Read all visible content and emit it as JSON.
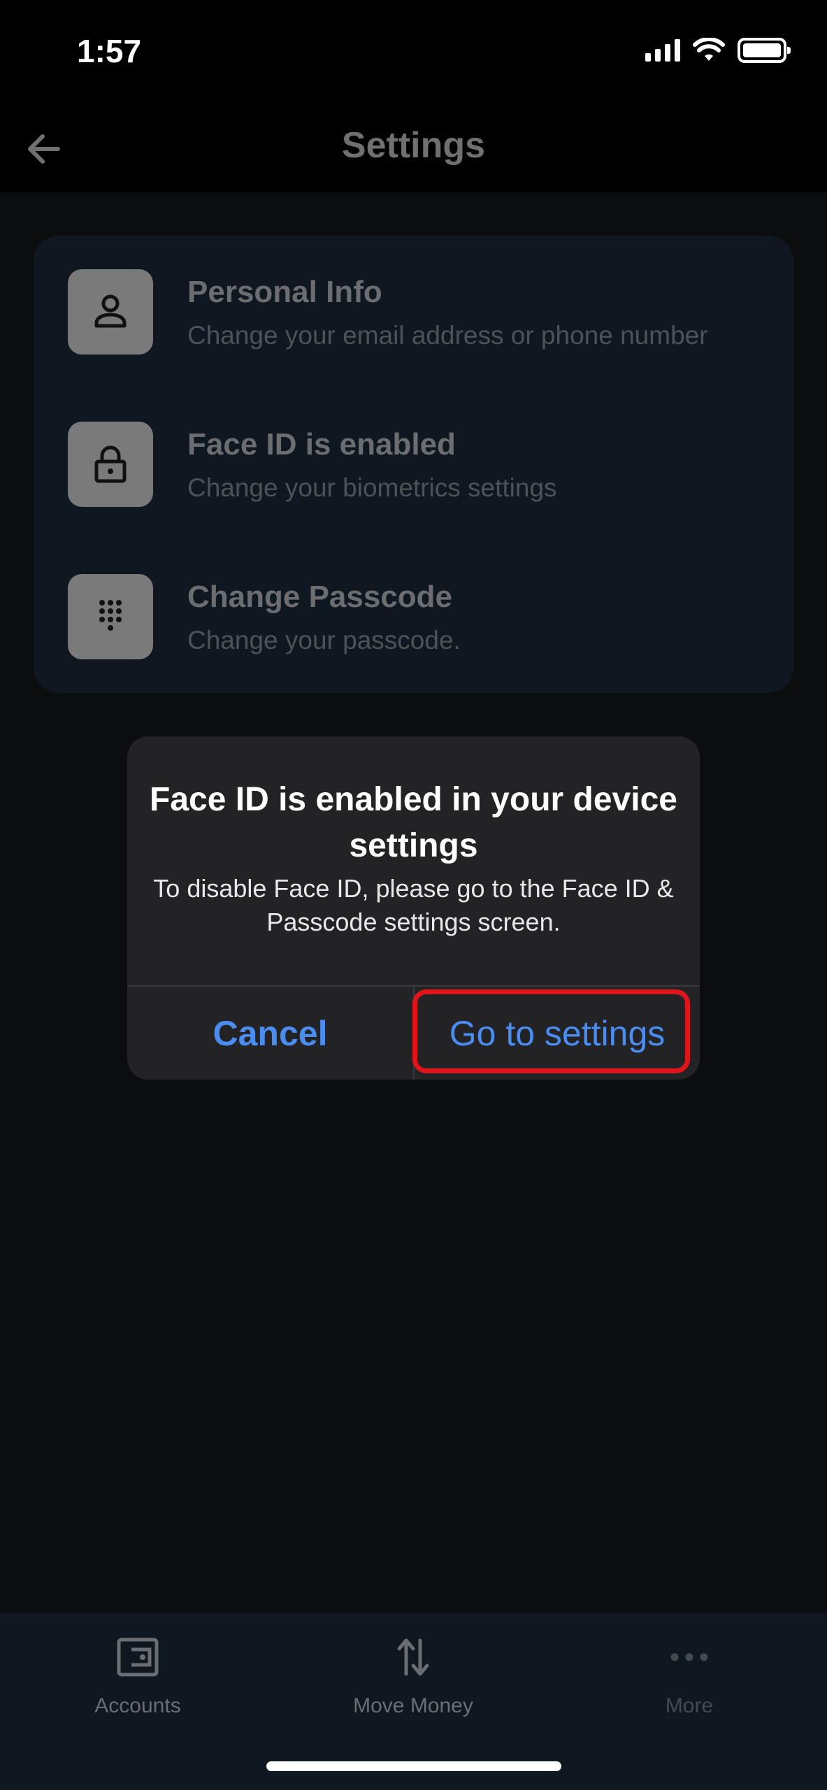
{
  "status_bar": {
    "time": "1:57",
    "icons": [
      "signal-icon",
      "wifi-icon",
      "battery-icon"
    ]
  },
  "header": {
    "title": "Settings",
    "back_icon": "arrow-left-icon"
  },
  "settings": {
    "items": [
      {
        "title": "Personal Info",
        "subtitle": "Change your email address or phone number",
        "icon": "person-icon"
      },
      {
        "title": "Face ID is enabled",
        "subtitle": "Change your biometrics settings",
        "icon": "lock-icon"
      },
      {
        "title": "Change Passcode",
        "subtitle": "Change your passcode.",
        "icon": "keypad-icon"
      }
    ]
  },
  "dialog": {
    "title": "Face ID is enabled in your device settings",
    "message": "To disable Face ID, please go to the Face ID & Passcode settings screen.",
    "cancel_label": "Cancel",
    "confirm_label": "Go to settings"
  },
  "colors": {
    "accent": "#4a8cf0",
    "highlight": "#e0141b",
    "card_bg": "#0f1820",
    "dialog_bg": "#232325"
  },
  "tab_bar": {
    "tabs": [
      {
        "label": "Accounts",
        "icon": "wallet-icon"
      },
      {
        "label": "Move Money",
        "icon": "transfer-arrows-icon"
      },
      {
        "label": "More",
        "icon": "more-dots-icon"
      }
    ]
  }
}
